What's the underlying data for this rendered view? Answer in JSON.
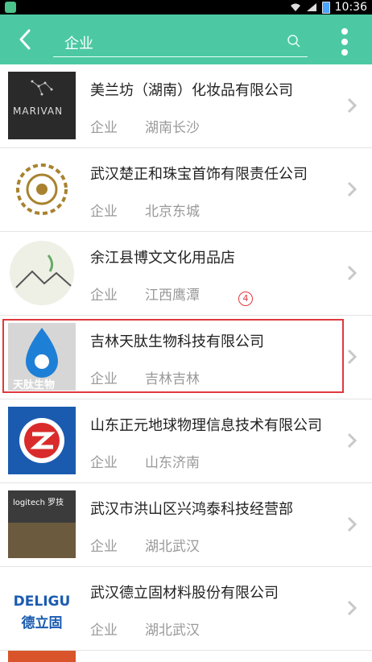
{
  "status": {
    "time": "10:36"
  },
  "search": {
    "value": "企业"
  },
  "accent": "#4cc9a3",
  "items": [
    {
      "name": "美兰坊（湖南）化妆品有限公司",
      "type": "企业",
      "location": "湖南长沙",
      "logo_text": "MARIVAN"
    },
    {
      "name": "武汉楚正和珠宝首饰有限责任公司",
      "type": "企业",
      "location": "北京东城"
    },
    {
      "name": "余江县博文文化用品店",
      "type": "企业",
      "location": "江西鹰潭"
    },
    {
      "name": "吉林天肽生物科技有限公司",
      "type": "企业",
      "location": "吉林吉林",
      "logo_text": "天肽生物"
    },
    {
      "name": "山东正元地球物理信息技术有限公司",
      "type": "企业",
      "location": "山东济南"
    },
    {
      "name": "武汉市洪山区兴鸿泰科技经营部",
      "type": "企业",
      "location": "湖北武汉",
      "logo_text": "logitech 罗技"
    },
    {
      "name": "武汉德立固材料股份有限公司",
      "type": "企业",
      "location": "湖北武汉",
      "logo_text": "DELIGU",
      "logo_text_cn": "德立固"
    }
  ],
  "annotation": {
    "label": "4"
  }
}
